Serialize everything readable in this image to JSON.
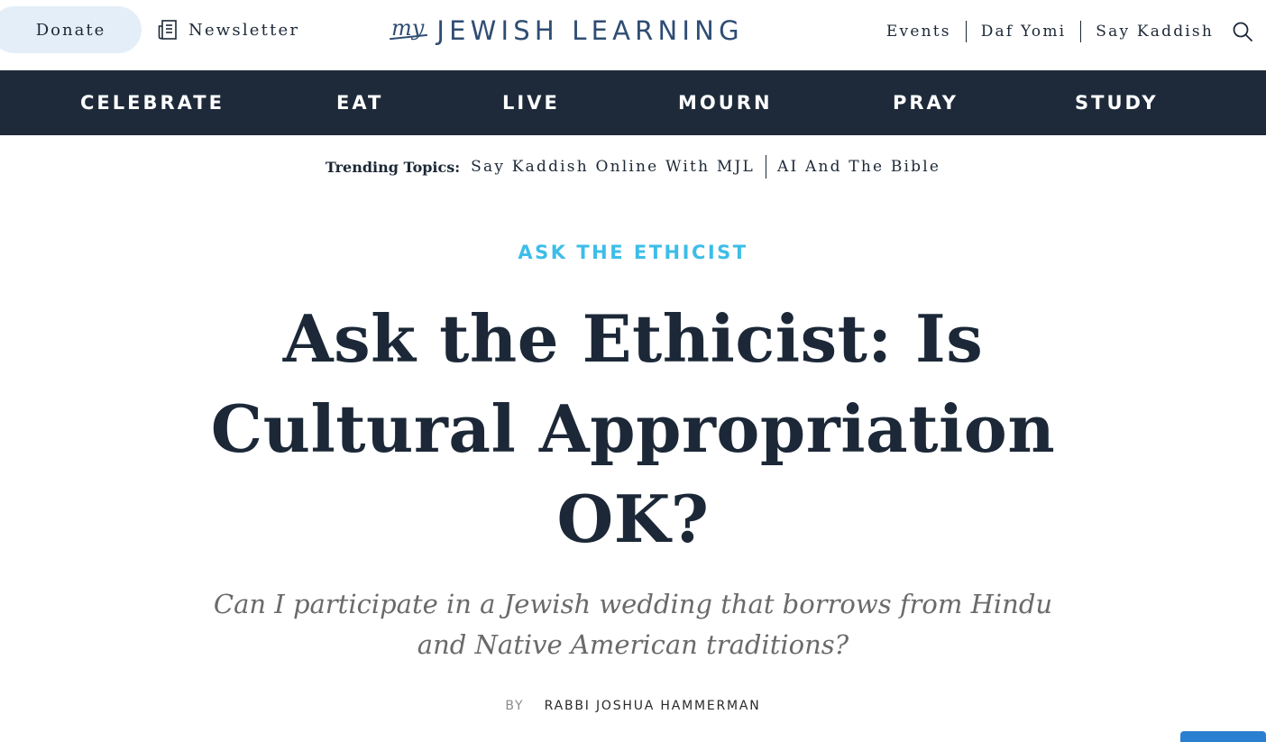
{
  "header": {
    "donate_label": "Donate",
    "newsletter_label": "Newsletter",
    "logo_my": "my",
    "logo_word": "JEWISH LEARNING",
    "util_links": [
      "Events",
      "Daf Yomi",
      "Say Kaddish"
    ],
    "search_icon": "search-icon"
  },
  "nav": {
    "items": [
      "CELEBRATE",
      "EAT",
      "LIVE",
      "MOURN",
      "PRAY",
      "STUDY"
    ]
  },
  "trending": {
    "label": "Trending Topics:",
    "links": [
      "Say Kaddish Online With MJL",
      "AI And The Bible"
    ]
  },
  "article": {
    "category": "ASK THE ETHICIST",
    "title": "Ask the Ethicist: Is Cultural Appropriation OK?",
    "subtitle": "Can I participate in a Jewish wedding that borrows from Hindu and Native American traditions?",
    "byline_prefix": "BY",
    "author": "RABBI JOSHUA HAMMERMAN"
  },
  "colors": {
    "navy": "#1e2a3a",
    "logo_blue": "#2f4d73",
    "accent_cyan": "#3dbde8",
    "donate_bg": "#e3eef8"
  }
}
